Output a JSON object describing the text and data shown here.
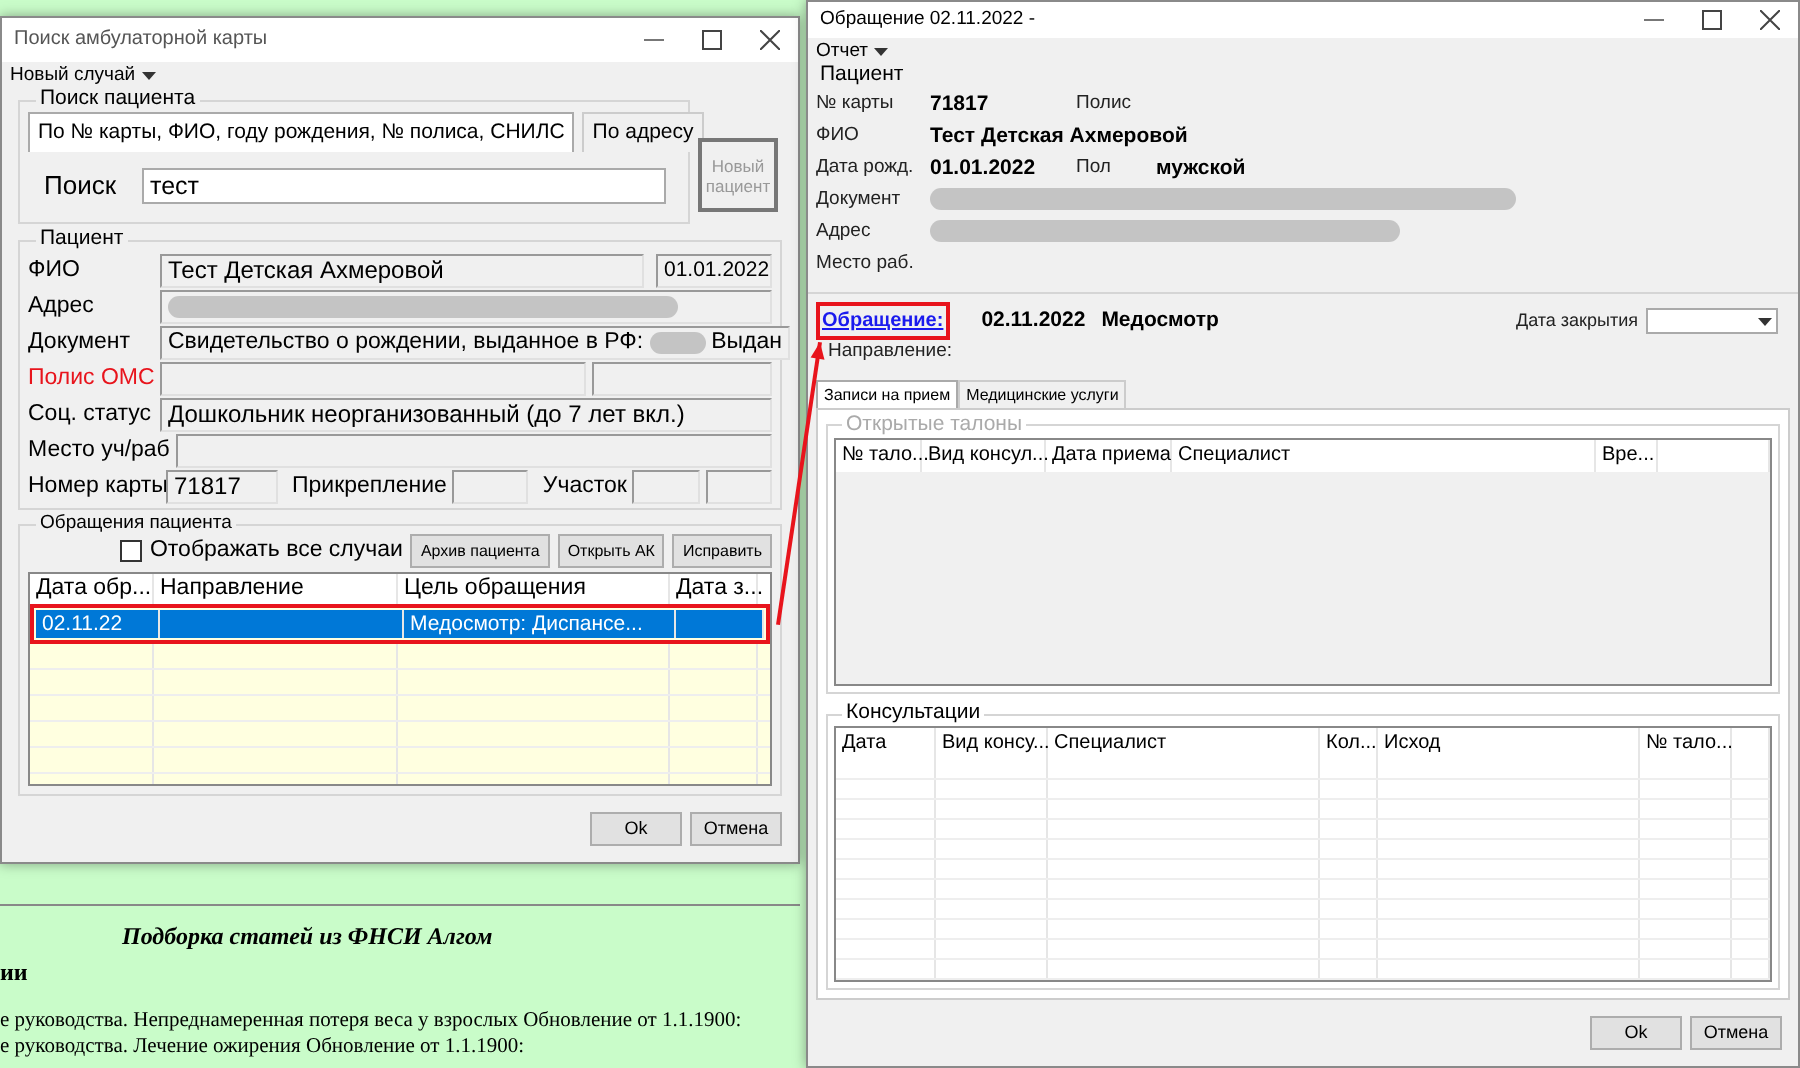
{
  "background_page": {
    "heading": "Подборка статей из ФНСИ Алгом",
    "fragment": "ии",
    "articles": [
      {
        "link": "е руководства. Непреднамеренная потеря веса у взрослых",
        "text": "Обновление от 1.1.1900:"
      },
      {
        "link": "е руководства. Лечение ожирения",
        "text": "Обновление от 1.1.1900:"
      }
    ]
  },
  "search_window": {
    "title": "Поиск амбулаторной карты",
    "menu": "Новый случай",
    "search_group": {
      "title": "Поиск пациента",
      "tabs": [
        {
          "label": "По № карты, ФИО, году рождения, № полиса, СНИЛС",
          "selected": true
        },
        {
          "label": "По адресу",
          "selected": false
        }
      ],
      "search_label": "Поиск",
      "search_value": "тест",
      "new_patient_button": {
        "label": "Новый пациент",
        "disabled": true
      }
    },
    "patient": {
      "title": "Пациент",
      "fio": {
        "label": "ФИО",
        "value": "Тест Детская Ахмеровой",
        "birth_date": "01.01.2022"
      },
      "address": {
        "label": "Адрес"
      },
      "document": {
        "label": "Документ",
        "value": "Свидетельство о рождении, выданное в РФ:",
        "value_end": "Выдан"
      },
      "policy": {
        "label": "Полис ОМС",
        "required": true
      },
      "social_status": {
        "label": "Соц. статус",
        "value": "Дошкольник неорганизованный (до 7 лет вкл.)"
      },
      "workplace": {
        "label": "Место уч/раб"
      },
      "card": {
        "label": "Номер карты",
        "value": "71817",
        "attach_label": "Прикрепление",
        "district_label": "Участок"
      }
    },
    "visits": {
      "title": "Обращения пациента",
      "checkbox": {
        "label": "Отображать все случаи",
        "checked": false
      },
      "buttons": [
        "Архив пациента",
        "Открыть АК",
        "Исправить"
      ],
      "columns": [
        "Дата обр...",
        "Направление",
        "Цель обращения",
        "Дата з..."
      ],
      "rows": [
        {
          "cells": [
            "02.11.22",
            "",
            "Медосмотр: Диспансе...",
            ""
          ],
          "selected": true,
          "highlighted": true
        }
      ]
    },
    "buttons": [
      "Ok",
      "Отмена"
    ]
  },
  "visit_window": {
    "title": "Обращение 02.11.2022 -",
    "menu": "Отчет",
    "patient": {
      "title": "Пациент",
      "card_label": "№ карты",
      "card_value": "71817",
      "policy_label": "Полис",
      "fio_label": "ФИО",
      "fio_value": "Тест Детская Ахмеровой",
      "birth_label": "Дата рожд.",
      "birth_value": "01.01.2022",
      "sex_label": "Пол",
      "sex_value": "мужской",
      "document_label": "Документ",
      "address_label": "Адрес",
      "workplace_label": "Место раб."
    },
    "visit": {
      "link": "Обращение:",
      "highlighted": true,
      "date": "02.11.2022",
      "purpose": "Медосмотр",
      "direction_label": "Направление:",
      "close_date_label": "Дата закрытия"
    },
    "tabs": [
      {
        "label": "Записи на прием",
        "selected": true
      },
      {
        "label": "Медицинские услуги",
        "selected": false
      }
    ],
    "open_tickets": {
      "title": "Открытые талоны",
      "disabled": true,
      "columns": [
        "№ тало...",
        "Вид консул...",
        "Дата приема",
        "Специалист",
        "Вре..."
      ]
    },
    "consultations": {
      "title": "Консультации",
      "columns": [
        "Дата",
        "Вид консу...",
        "Специалист",
        "Кол...",
        "Исход",
        "№ тало..."
      ]
    },
    "buttons": [
      "Ok",
      "Отмена"
    ]
  }
}
